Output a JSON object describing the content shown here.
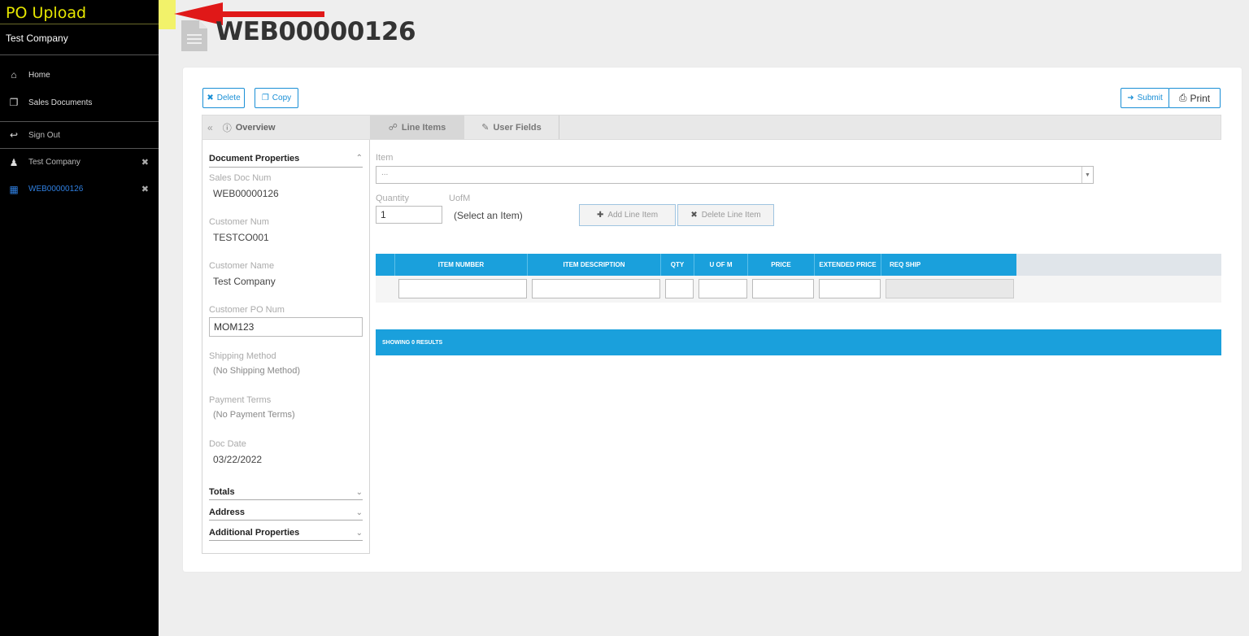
{
  "sidebar": {
    "app_title": "PO Upload",
    "company": "Test Company",
    "nav": [
      {
        "label": "Home",
        "icon": "home-icon"
      },
      {
        "label": "Sales Documents",
        "icon": "documents-icon"
      }
    ],
    "sign_out": "Sign Out",
    "open_items": [
      {
        "label": "Test Company",
        "icon": "user-icon"
      },
      {
        "label": "WEB00000126",
        "icon": "file-icon"
      }
    ]
  },
  "header": {
    "title": "WEB00000126"
  },
  "toolbar": {
    "delete_label": "Delete",
    "copy_label": "Copy",
    "submit_label": "Submit",
    "print_label": "Print"
  },
  "tabs": {
    "overview": "Overview",
    "line_items": "Line Items",
    "user_fields": "User Fields"
  },
  "properties": {
    "section_title": "Document Properties",
    "sales_doc_num_label": "Sales Doc Num",
    "sales_doc_num": "WEB00000126",
    "customer_num_label": "Customer Num",
    "customer_num": "TESTCO001",
    "customer_name_label": "Customer Name",
    "customer_name": "Test Company",
    "customer_po_label": "Customer PO Num",
    "customer_po": "MOM123",
    "shipping_label": "Shipping Method",
    "shipping": "(No Shipping Method)",
    "payment_label": "Payment Terms",
    "payment": "(No Payment Terms)",
    "doc_date_label": "Doc Date",
    "doc_date": "03/22/2022",
    "collapsed_sections": [
      "Totals",
      "Address",
      "Additional Properties"
    ]
  },
  "line_items": {
    "item_label": "Item",
    "item_placeholder": "...",
    "quantity_label": "Quantity",
    "quantity": "1",
    "uofm_label": "UofM",
    "uofm_value": "(Select an Item)",
    "add_label": "Add Line Item",
    "delete_label": "Delete Line Item",
    "columns": [
      "ITEM NUMBER",
      "ITEM DESCRIPTION",
      "QTY",
      "U OF M",
      "PRICE",
      "EXTENDED PRICE",
      "REQ SHIP"
    ],
    "results": "SHOWING 0 RESULTS"
  },
  "colors": {
    "accent": "#1aa0dc",
    "sidebar_bg": "#000000",
    "title_yellow": "#e6e600",
    "active_link": "#2f7fe0",
    "annotation_red": "#e01818"
  }
}
